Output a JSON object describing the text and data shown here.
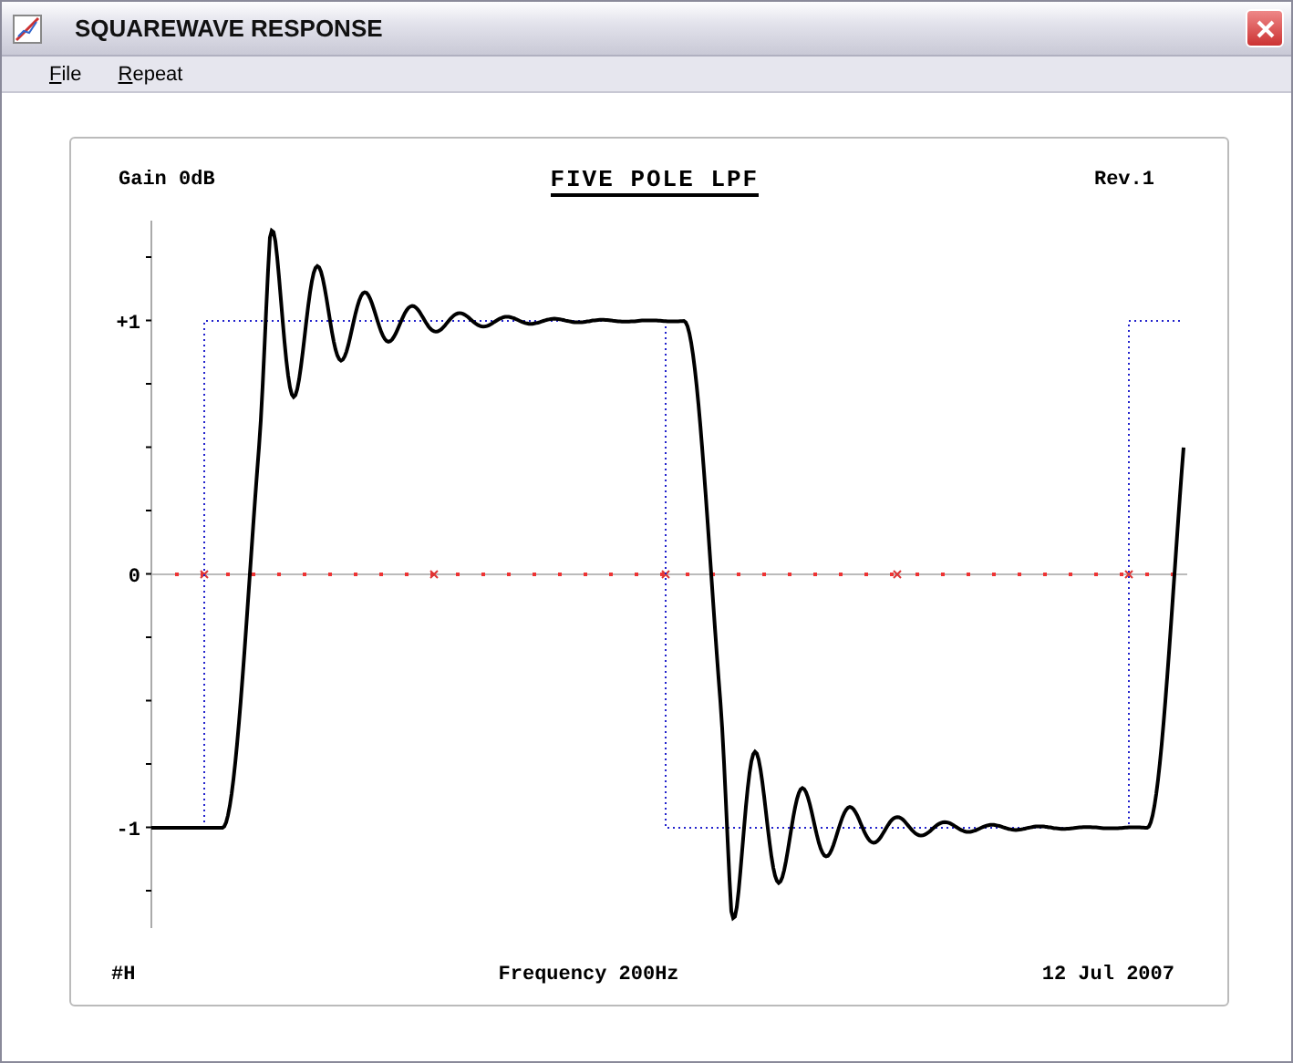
{
  "window": {
    "title": "SQUAREWAVE RESPONSE"
  },
  "menu": [
    {
      "label": "File"
    },
    {
      "label": "Repeat"
    }
  ],
  "plot": {
    "gain": "Gain 0dB",
    "title": "FIVE POLE LPF",
    "revision": "Rev.1",
    "y_labels": [
      "+1",
      "0",
      "-1"
    ],
    "footer_left": "#H",
    "frequency": "Frequency 200Hz",
    "date": "12 Jul 2007"
  }
}
